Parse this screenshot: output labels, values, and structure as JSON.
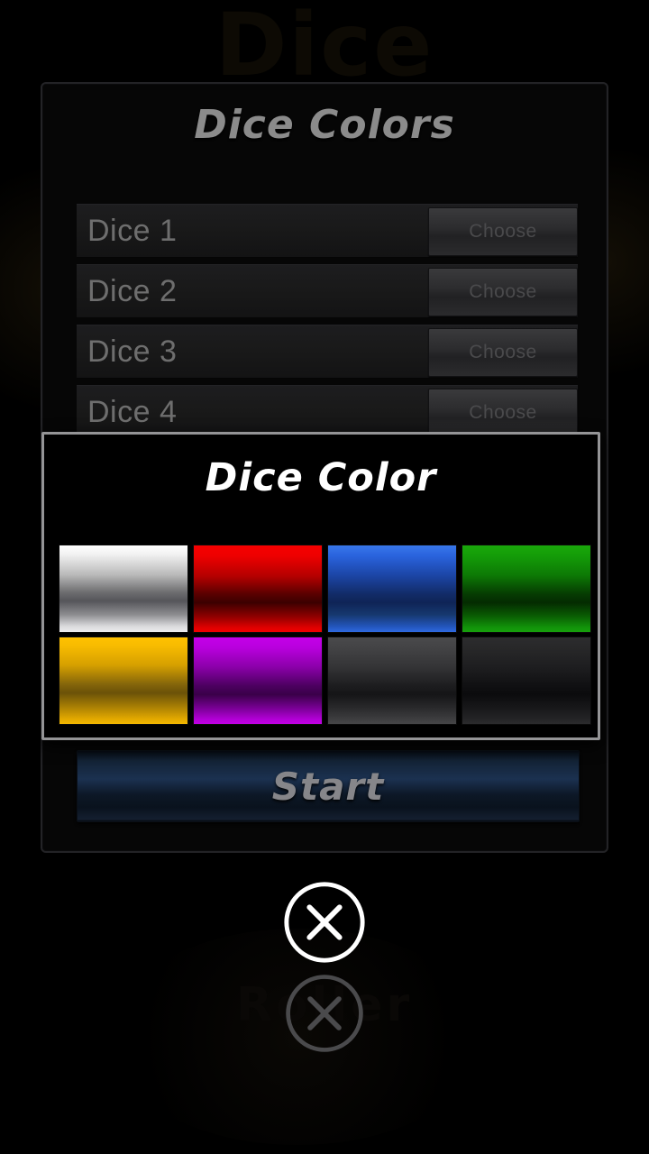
{
  "screen": {
    "background_color": "#000000",
    "ghost_title": "Dice",
    "ghost_subtitle": "Roller"
  },
  "panel": {
    "title": "Dice Colors",
    "title_color": "#8b8b8b",
    "border_color": "#232326",
    "dice_rows": [
      {
        "label": "Dice 1",
        "button_label": "Choose"
      },
      {
        "label": "Dice 2",
        "button_label": "Choose"
      },
      {
        "label": "Dice 3",
        "button_label": "Choose"
      },
      {
        "label": "Dice 4",
        "button_label": "Choose"
      }
    ],
    "start_button": {
      "label": "Start",
      "label_color": "#86868a",
      "accent_color": "#1b3150"
    }
  },
  "dialog": {
    "title": "Dice Color",
    "title_color": "#ffffff",
    "border_color": "#949496",
    "background_color": "#000000",
    "swatches": [
      {
        "name": "white",
        "color": "#ffffff",
        "class": "swatch-silver"
      },
      {
        "name": "red",
        "color": "#f60000",
        "class": "swatch-red"
      },
      {
        "name": "blue",
        "color": "#3877ea",
        "class": "swatch-blue"
      },
      {
        "name": "green",
        "color": "#1aa80a",
        "class": "swatch-green"
      },
      {
        "name": "yellow",
        "color": "#ffc100",
        "class": "swatch-gold"
      },
      {
        "name": "magenta",
        "color": "#c400e8",
        "class": "swatch-magenta"
      },
      {
        "name": "gray",
        "color": "#4a4a4c",
        "class": "swatch-gray"
      },
      {
        "name": "black",
        "color": "#2c2c2e",
        "class": "swatch-black"
      }
    ]
  },
  "navigation": {
    "close_icon_primary": {
      "icon": "close-circle-icon",
      "color": "#ffffff"
    },
    "close_icon_secondary": {
      "icon": "close-circle-icon",
      "color": "#4a4a4c"
    }
  }
}
